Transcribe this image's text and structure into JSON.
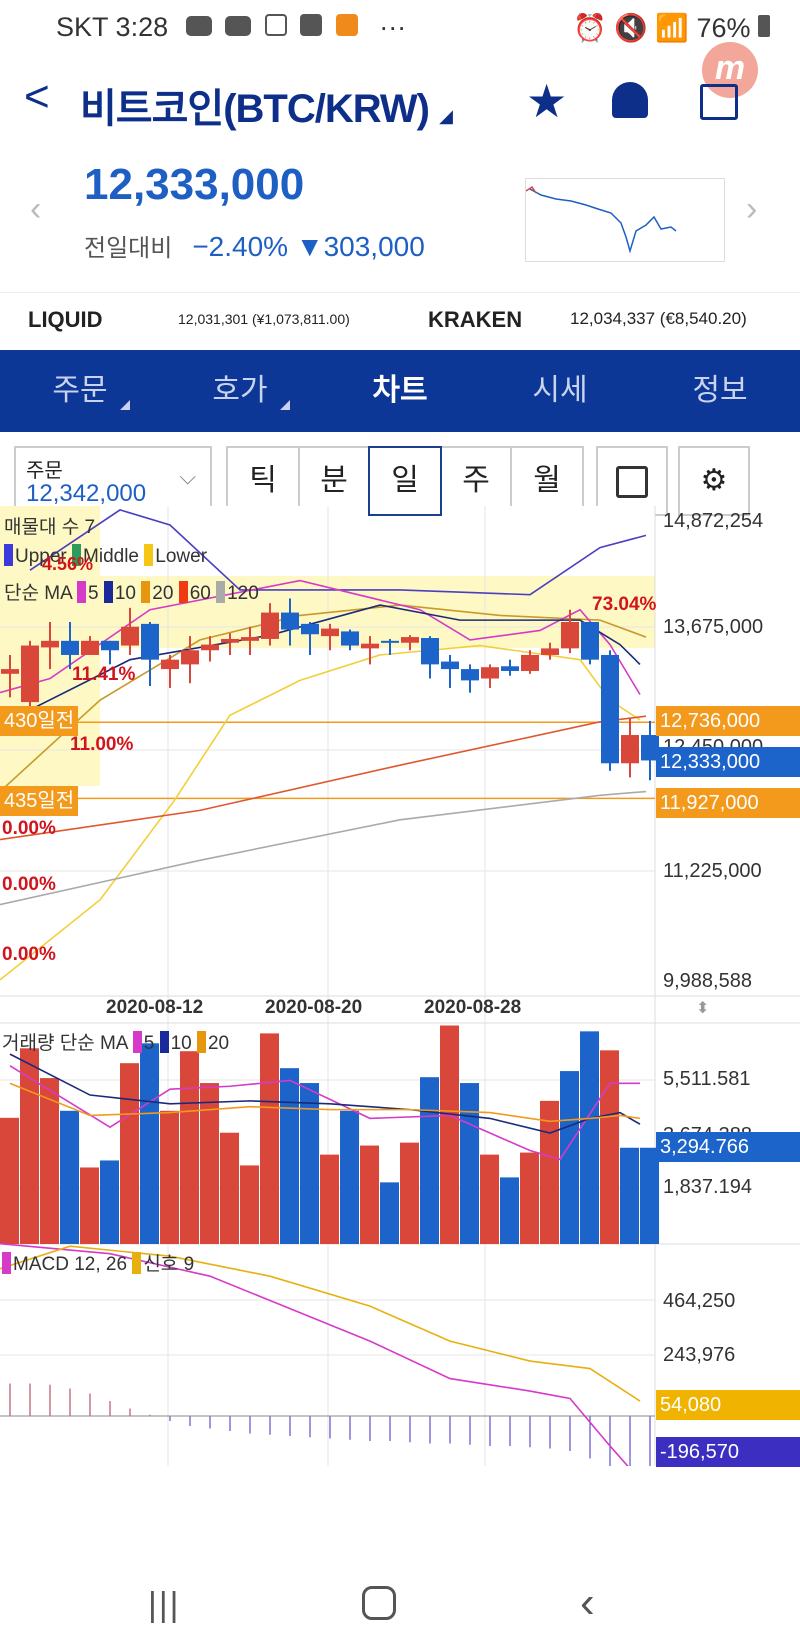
{
  "status": {
    "carrier": "SKT",
    "time": "3:28",
    "apps": [
      "youtube-icon",
      "youtube-icon",
      "app-icon",
      "m-icon",
      "b-icon"
    ],
    "more": "···",
    "battery": "76%"
  },
  "header": {
    "back": "<",
    "title": "비트코인(BTC/KRW)",
    "price": "12,333,000",
    "compare_label": "전일대비",
    "change_pct": "−2.40%",
    "change_abs": "▼303,000"
  },
  "exchanges": [
    {
      "name": "LIQUID",
      "value": "12,031,301 (¥1,073,811.00)"
    },
    {
      "name": "KRAKEN",
      "value": "12,034,337 (€8,540.20)"
    }
  ],
  "tabs": [
    {
      "label": "주문",
      "dropdown": true
    },
    {
      "label": "호가",
      "dropdown": true
    },
    {
      "label": "차트",
      "active": true
    },
    {
      "label": "시세"
    },
    {
      "label": "정보"
    }
  ],
  "order": {
    "label": "주문",
    "value": "12,342,000"
  },
  "periods": [
    "틱",
    "분",
    "일",
    "주",
    "월"
  ],
  "active_period": "일",
  "colors": {
    "up": "#d9473a",
    "down": "#1c64c9",
    "nav": "#0c3796",
    "accent": "#f39a1c"
  },
  "chart_data": {
    "type": "candlestick",
    "price_axis": {
      "ylim": [
        9988588,
        14872254
      ],
      "ticks": [
        "14,872,254",
        "13,675,000",
        "12,450,000",
        "11,225,000",
        "9,988,588"
      ]
    },
    "price_tags": [
      {
        "label": "12,736,000",
        "value": 12736000,
        "color": "#f39a1c"
      },
      {
        "label": "12,333,000",
        "value": 12333000,
        "color": "#1c64c9"
      },
      {
        "label": "11,927,000",
        "value": 11927000,
        "color": "#f39a1c"
      }
    ],
    "level_lines": [
      {
        "label": "430일전",
        "value": 12736000
      },
      {
        "label": "435일전",
        "value": 11927000
      }
    ],
    "volume_profile_title": "매물대 수 7",
    "profile_pcts": [
      "4.56%",
      "11.41%",
      "11.00%",
      "73.04%",
      "0.00%",
      "0.00%",
      "0.00%"
    ],
    "bollinger_legend": [
      "Upper",
      "Middle",
      "Lower"
    ],
    "ma_legend": {
      "title": "단순 MA",
      "periods": [
        "5",
        "10",
        "20",
        "60",
        "120"
      ]
    },
    "dates": [
      "2020-08-12",
      "2020-08-20",
      "2020-08-28"
    ],
    "date_index": [
      8,
      16,
      24
    ],
    "candles": [
      [
        13.25,
        13.3,
        13.45,
        13.0
      ],
      [
        12.95,
        13.55,
        13.6,
        12.9
      ],
      [
        13.53,
        13.6,
        13.8,
        13.3
      ],
      [
        13.6,
        13.45,
        13.8,
        13.3
      ],
      [
        13.45,
        13.6,
        13.65,
        13.45
      ],
      [
        13.6,
        13.5,
        13.6,
        13.35
      ],
      [
        13.55,
        13.75,
        13.95,
        13.45
      ],
      [
        13.78,
        13.4,
        13.8,
        13.12
      ],
      [
        13.3,
        13.4,
        13.45,
        13.1
      ],
      [
        13.35,
        13.5,
        13.65,
        13.15
      ],
      [
        13.5,
        13.56,
        13.65,
        13.38
      ],
      [
        13.58,
        13.62,
        13.68,
        13.45
      ],
      [
        13.6,
        13.64,
        13.75,
        13.45
      ],
      [
        13.62,
        13.9,
        14.0,
        13.55
      ],
      [
        13.9,
        13.72,
        14.05,
        13.55
      ],
      [
        13.78,
        13.67,
        13.8,
        13.45
      ],
      [
        13.65,
        13.73,
        13.78,
        13.5
      ],
      [
        13.7,
        13.55,
        13.72,
        13.5
      ],
      [
        13.52,
        13.57,
        13.65,
        13.35
      ],
      [
        13.6,
        13.58,
        13.62,
        13.45
      ],
      [
        13.58,
        13.64,
        13.66,
        13.5
      ],
      [
        13.63,
        13.35,
        13.65,
        13.2
      ],
      [
        13.38,
        13.3,
        13.45,
        13.1
      ],
      [
        13.3,
        13.18,
        13.35,
        13.05
      ],
      [
        13.2,
        13.32,
        13.35,
        13.1
      ],
      [
        13.33,
        13.28,
        13.4,
        13.23
      ],
      [
        13.28,
        13.45,
        13.5,
        13.25
      ],
      [
        13.45,
        13.52,
        13.58,
        13.4
      ],
      [
        13.52,
        13.8,
        13.93,
        13.47
      ],
      [
        13.8,
        13.4,
        13.8,
        13.35
      ],
      [
        13.45,
        12.3,
        13.5,
        12.22
      ],
      [
        12.3,
        12.6,
        12.78,
        12.15
      ],
      [
        12.6,
        12.33,
        12.75,
        12.12
      ]
    ],
    "candle_unit": "million KRW",
    "lines": [
      {
        "name": "upper",
        "color": "#4a3fc0",
        "pts": [
          [
            1,
            14.35
          ],
          [
            5.5,
            14.99
          ],
          [
            8,
            14.83
          ],
          [
            11.5,
            14.14
          ],
          [
            19.5,
            14.14
          ],
          [
            26,
            14.09
          ],
          [
            29.5,
            14.59
          ],
          [
            31.8,
            14.72
          ]
        ]
      },
      {
        "name": "lower",
        "color": "#f2cf3a",
        "pts": [
          [
            -0.5,
            10.0
          ],
          [
            4.5,
            10.85
          ],
          [
            8.2,
            11.9
          ],
          [
            11,
            12.81
          ],
          [
            14.5,
            13.18
          ],
          [
            18.5,
            13.45
          ],
          [
            23.5,
            13.55
          ],
          [
            28.5,
            13.4
          ],
          [
            30,
            12.97
          ],
          [
            31.5,
            12.76
          ]
        ]
      },
      {
        "name": "ma20",
        "color": "#c99a2a",
        "pts": [
          [
            -0.5,
            12.0
          ],
          [
            4.5,
            12.97
          ],
          [
            9.5,
            13.61
          ],
          [
            14.5,
            13.87
          ],
          [
            19.5,
            13.98
          ],
          [
            24.5,
            13.87
          ],
          [
            29.5,
            13.82
          ],
          [
            31.8,
            13.64
          ]
        ]
      },
      {
        "name": "ma60",
        "color": "#e0572e",
        "pts": [
          [
            -0.5,
            11.49
          ],
          [
            9.5,
            11.8
          ],
          [
            19.5,
            12.28
          ],
          [
            29.5,
            12.74
          ],
          [
            31.8,
            12.8
          ]
        ]
      },
      {
        "name": "ma120",
        "color": "#aaaaaa",
        "pts": [
          [
            -0.5,
            10.8
          ],
          [
            9.5,
            11.27
          ],
          [
            19.5,
            11.7
          ],
          [
            29.5,
            11.96
          ],
          [
            31.8,
            12.0
          ]
        ]
      },
      {
        "name": "ma5",
        "color": "#d63ac8",
        "pts": [
          [
            -0.5,
            13.05
          ],
          [
            2,
            13.2
          ],
          [
            7,
            13.93
          ],
          [
            14.5,
            14.24
          ],
          [
            20.5,
            13.93
          ],
          [
            23,
            13.61
          ],
          [
            26.5,
            13.71
          ],
          [
            28.5,
            13.93
          ],
          [
            30,
            13.56
          ],
          [
            31.5,
            13.03
          ]
        ]
      },
      {
        "name": "ma10",
        "color": "#1a2a7a",
        "pts": [
          [
            0,
            12.76
          ],
          [
            6,
            13.4
          ],
          [
            13,
            13.66
          ],
          [
            18.5,
            13.98
          ],
          [
            22.5,
            13.82
          ],
          [
            26,
            13.82
          ],
          [
            28.5,
            13.82
          ],
          [
            30.5,
            13.56
          ],
          [
            31.5,
            13.35
          ]
        ]
      }
    ],
    "volume": {
      "title": "거래량 단순 MA",
      "periods": [
        "5",
        "10",
        "20"
      ],
      "ticks": [
        "5,511.581",
        "3,674,388",
        "1,837.194"
      ],
      "current": "3,294.766",
      "ylim": [
        0,
        7600
      ],
      "bars": [
        [
          4320,
          1
        ],
        [
          6700,
          1
        ],
        [
          5680,
          1
        ],
        [
          4560,
          0
        ],
        [
          2620,
          1
        ],
        [
          2860,
          0
        ],
        [
          6190,
          1
        ],
        [
          6870,
          0
        ],
        [
          4560,
          1
        ],
        [
          6600,
          1
        ],
        [
          5510,
          1
        ],
        [
          3810,
          1
        ],
        [
          2690,
          1
        ],
        [
          7210,
          1
        ],
        [
          6020,
          0
        ],
        [
          5510,
          0
        ],
        [
          3060,
          1
        ],
        [
          4560,
          0
        ],
        [
          3370,
          1
        ],
        [
          2110,
          0
        ],
        [
          3470,
          1
        ],
        [
          5710,
          0
        ],
        [
          7480,
          1
        ],
        [
          5510,
          0
        ],
        [
          3060,
          1
        ],
        [
          2280,
          0
        ],
        [
          3130,
          1
        ],
        [
          4900,
          1
        ],
        [
          5920,
          0
        ],
        [
          7280,
          0
        ],
        [
          6630,
          1
        ],
        [
          3295,
          0
        ],
        [
          3295,
          0
        ]
      ],
      "lines": [
        {
          "color": "#d63ac8",
          "pts": [
            [
              0,
              6100
            ],
            [
              5,
              4000
            ],
            [
              8,
              5300
            ],
            [
              11,
              5400
            ],
            [
              14,
              5600
            ],
            [
              18,
              4300
            ],
            [
              22,
              4400
            ],
            [
              26,
              3200
            ],
            [
              27.5,
              2900
            ],
            [
              30,
              5500
            ],
            [
              31.5,
              5500
            ]
          ]
        },
        {
          "color": "#1a2a7a",
          "pts": [
            [
              0,
              6500
            ],
            [
              4,
              5100
            ],
            [
              8,
              4800
            ],
            [
              12,
              4900
            ],
            [
              16,
              4800
            ],
            [
              20,
              4600
            ],
            [
              24,
              4300
            ],
            [
              27,
              3800
            ],
            [
              29,
              4300
            ],
            [
              30.5,
              4500
            ],
            [
              31.5,
              4100
            ]
          ]
        },
        {
          "color": "#f39a1c",
          "pts": [
            [
              0,
              5500
            ],
            [
              4,
              4400
            ],
            [
              8,
              4500
            ],
            [
              12,
              4700
            ],
            [
              16,
              4600
            ],
            [
              20,
              4600
            ],
            [
              24,
              4500
            ],
            [
              27,
              4200
            ],
            [
              29,
              4300
            ],
            [
              30.5,
              4400
            ],
            [
              31.5,
              4300
            ]
          ]
        }
      ]
    },
    "macd": {
      "title": "MACD 12, 26",
      "signal_title": "신호 9",
      "ticks": [
        "464,250",
        "243,976"
      ],
      "macd_value": "54,080",
      "signal_value": "-196,570",
      "ylim": [
        -270000,
        720000
      ],
      "macd": [
        [
          -0.5,
          690000
        ],
        [
          5,
          650000
        ],
        [
          10,
          560000
        ],
        [
          14,
          430000
        ],
        [
          18,
          300000
        ],
        [
          22,
          150000
        ],
        [
          26,
          100000
        ],
        [
          28,
          70000
        ],
        [
          30,
          -120000
        ],
        [
          31.5,
          -256000
        ]
      ],
      "signal": [
        [
          -0.5,
          590000
        ],
        [
          3,
          680000
        ],
        [
          8,
          640000
        ],
        [
          13,
          560000
        ],
        [
          18,
          440000
        ],
        [
          22,
          300000
        ],
        [
          26,
          220000
        ],
        [
          29,
          190000
        ],
        [
          31.5,
          60000
        ]
      ],
      "hist": [
        130000,
        130000,
        125000,
        110000,
        90000,
        60000,
        30000,
        5000,
        -20000,
        -40000,
        -50000,
        -60000,
        -70000,
        -75000,
        -80000,
        -85000,
        -90000,
        -95000,
        -100000,
        -100000,
        -105000,
        -110000,
        -110000,
        -115000,
        -120000,
        -120000,
        -125000,
        -130000,
        -140000,
        -170000,
        -200000,
        -230000,
        -256000
      ]
    }
  },
  "bottom_nav": [
    "recent-apps",
    "home",
    "back"
  ]
}
